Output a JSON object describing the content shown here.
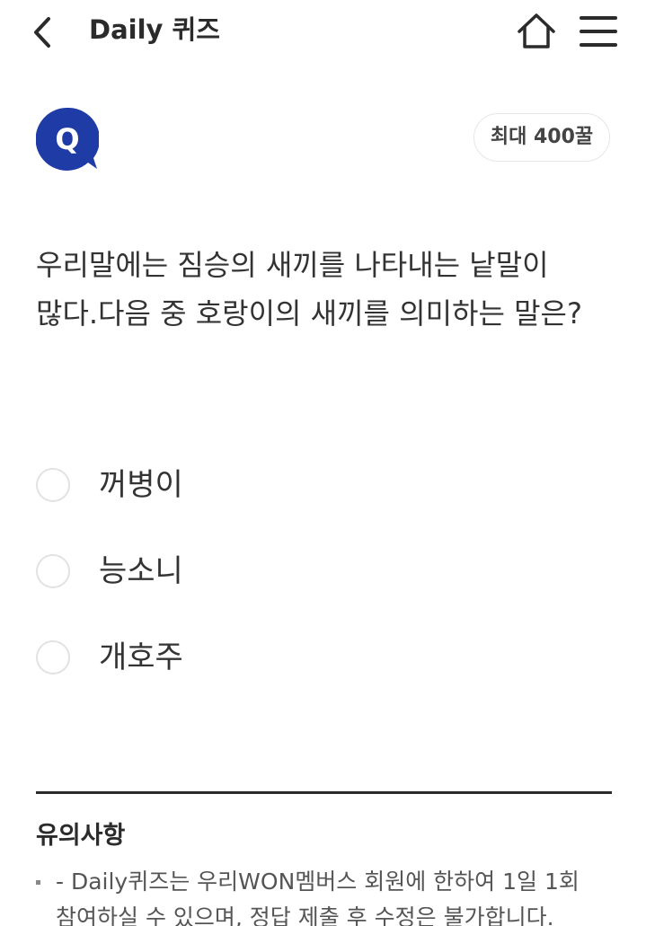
{
  "header": {
    "title": "Daily 퀴즈",
    "back_icon": "chevron-left-icon",
    "home_icon": "home-icon",
    "menu_icon": "hamburger-menu-icon"
  },
  "quiz": {
    "badge_letter": "Q",
    "badge_color": "#1E3BA6",
    "max_points_label": "최대 400꿀",
    "question": "우리말에는 짐승의 새끼를 나타내는 낱말이 많다.다음 중 호랑이의 새끼를 의미하는 말은?",
    "options": [
      {
        "label": "꺼병이",
        "selected": false
      },
      {
        "label": "능소니",
        "selected": false
      },
      {
        "label": "개호주",
        "selected": false
      }
    ]
  },
  "notice": {
    "title": "유의사항",
    "items": [
      "- Daily퀴즈는 우리WON멤버스 회원에 한하여 1일 1회 참여하실 수 있으며, 정답 제출 후 수정은 불가합니다."
    ]
  }
}
